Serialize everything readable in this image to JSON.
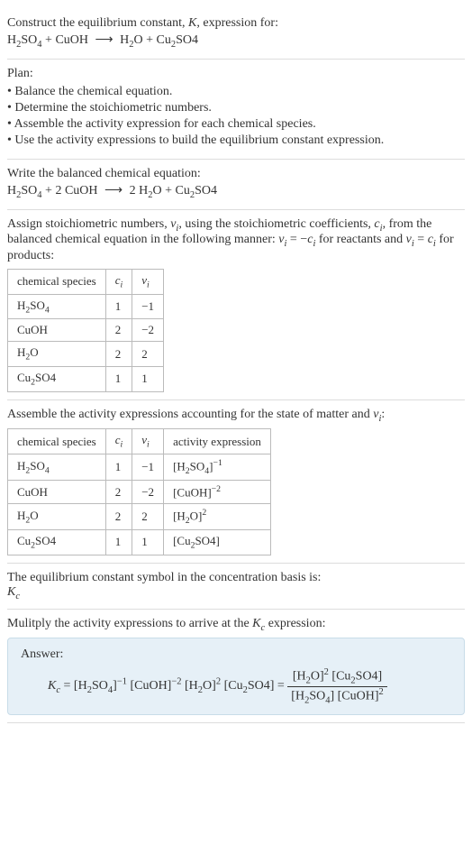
{
  "intro": {
    "line1": "Construct the equilibrium constant, ",
    "Ksym": "K",
    "line1b": ", expression for:",
    "eq_lhs1": "H",
    "eq_lhs1b": "2",
    "eq_lhs1c": "SO",
    "eq_lhs1d": "4",
    "plus": " + ",
    "cuoh": "CuOH",
    "arrow": "⟶",
    "h2o_a": "H",
    "h2o_b": "2",
    "h2o_c": "O",
    "cu2": "Cu",
    "cu2b": "2",
    "so4": "SO4"
  },
  "plan": {
    "title": "Plan:",
    "items": [
      "Balance the chemical equation.",
      "Determine the stoichiometric numbers.",
      "Assemble the activity expression for each chemical species.",
      "Use the activity expressions to build the equilibrium constant expression."
    ]
  },
  "balanced": {
    "title": "Write the balanced chemical equation:",
    "coef2a": "2",
    "coef2b": "2"
  },
  "assign": {
    "text1": "Assign stoichiometric numbers, ",
    "nu": "ν",
    "sub_i": "i",
    "text2": ", using the stoichiometric coefficients, ",
    "c": "c",
    "text3": ", from the balanced chemical equation in the following manner: ",
    "rel1a": "ν",
    "rel1b": "i",
    "rel1c": " = −",
    "rel1d": "c",
    "rel1e": "i",
    "text4": " for reactants and ",
    "rel2a": "ν",
    "rel2b": "i",
    "rel2c": " = ",
    "rel2d": "c",
    "rel2e": "i",
    "text5": " for products:",
    "headers": {
      "species": "chemical species",
      "ci": "c",
      "sub": "i",
      "nu": "ν"
    },
    "rows": [
      {
        "name": "H2SO4",
        "ci": "1",
        "nu": "−1"
      },
      {
        "name": "CuOH",
        "ci": "2",
        "nu": "−2"
      },
      {
        "name": "H2O",
        "ci": "2",
        "nu": "2"
      },
      {
        "name": "Cu2SO4",
        "ci": "1",
        "nu": "1"
      }
    ]
  },
  "activity": {
    "title1": "Assemble the activity expressions accounting for the state of matter and ",
    "nu": "ν",
    "sub_i": "i",
    "colon": ":",
    "headers": {
      "species": "chemical species",
      "ci": "c",
      "sub": "i",
      "nu": "ν",
      "act": "activity expression"
    },
    "rows": [
      {
        "name": "H2SO4",
        "ci": "1",
        "nu": "−1",
        "exp": "−1"
      },
      {
        "name": "CuOH",
        "ci": "2",
        "nu": "−2",
        "exp": "−2"
      },
      {
        "name": "H2O",
        "ci": "2",
        "nu": "2",
        "exp": "2"
      },
      {
        "name": "Cu2SO4",
        "ci": "1",
        "nu": "1",
        "exp": ""
      }
    ]
  },
  "symbol": {
    "text": "The equilibrium constant symbol in the concentration basis is:",
    "K": "K",
    "c": "c"
  },
  "multiply": {
    "text": "Mulitply the activity expressions to arrive at the ",
    "K": "K",
    "c": "c",
    "text2": " expression:"
  },
  "answer": {
    "label": "Answer:",
    "K": "K",
    "c": "c",
    "eq": " = ",
    "exp_m1": "−1",
    "exp_m2": "−2",
    "exp_2": "2"
  }
}
